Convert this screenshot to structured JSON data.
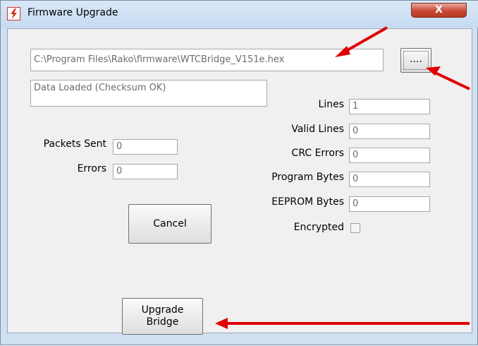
{
  "window": {
    "title": "Firmware Upgrade",
    "close_label": "X"
  },
  "file": {
    "path": "C:\\Program Files\\Rako\\firmware\\WTCBridge_V151e.hex",
    "browse_label": "...."
  },
  "status": "Data Loaded (Checksum OK)",
  "stats": {
    "lines_label": "Lines",
    "lines": "1",
    "valid_lines_label": "Valid Lines",
    "valid_lines": "0",
    "crc_errors_label": "CRC Errors",
    "crc_errors": "0",
    "program_bytes_label": "Program Bytes",
    "program_bytes": "0",
    "eeprom_bytes_label": "EEPROM Bytes",
    "eeprom_bytes": "0",
    "encrypted_label": "Encrypted",
    "encrypted": false
  },
  "transfer": {
    "packets_sent_label": "Packets Sent",
    "packets_sent": "0",
    "errors_label": "Errors",
    "errors": "0"
  },
  "buttons": {
    "cancel": "Cancel",
    "upgrade_line1": "Upgrade",
    "upgrade_line2": "Bridge"
  },
  "annotation_color": "#e00000"
}
